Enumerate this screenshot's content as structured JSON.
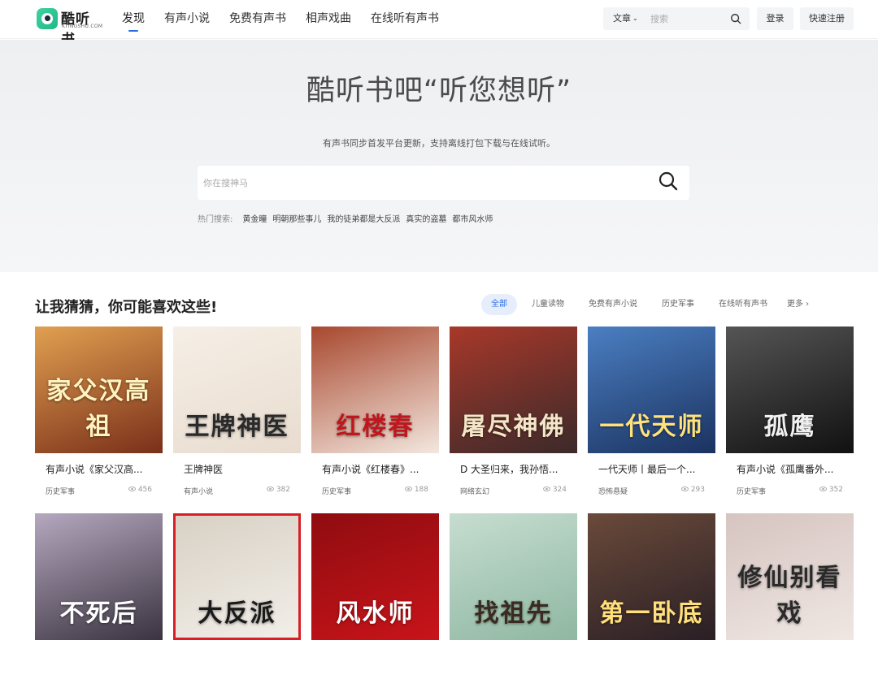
{
  "header": {
    "logo_title": "酷听书",
    "logo_sub": "KTINGSHU.COM",
    "nav": [
      "发现",
      "有声小说",
      "免费有声书",
      "相声戏曲",
      "在线听有声书"
    ],
    "search_category": "文章",
    "search_placeholder": "搜索",
    "login": "登录",
    "register": "快速注册"
  },
  "hero": {
    "title": "酷听书吧“听您想听”",
    "subtitle": "有声书同步首发平台更新，支持离线打包下载与在线试听。",
    "search_placeholder": "你在搜神马",
    "hot_label": "热门搜索:",
    "hot_items": [
      "黄金瞳",
      "明朝那些事儿",
      "我的徒弟都是大反派",
      "真实的盗墓",
      "都市风水师"
    ]
  },
  "recommend": {
    "title": "让我猜猜，你可能喜欢这些!",
    "tabs": [
      "全部",
      "儿童读物",
      "免费有声小说",
      "历史军事",
      "在线听有声书"
    ],
    "more": "更多 ›",
    "books": [
      {
        "title": "有声小说《家父汉高...",
        "category": "历史军事",
        "plays": "456",
        "cover_text": "家父汉高祖",
        "bg": "#7a2f1a",
        "bg2": "#e0a050",
        "fg": "#fff3c0"
      },
      {
        "title": "王牌神医",
        "category": "有声小说",
        "plays": "382",
        "cover_text": "王牌神医",
        "bg": "#e8dccf",
        "bg2": "#f6efe6",
        "fg": "#2a2a2a"
      },
      {
        "title": "有声小说《红楼春》...",
        "category": "历史军事",
        "plays": "188",
        "cover_text": "红楼春",
        "bg": "#f3e7df",
        "bg2": "#a8482e",
        "fg": "#c0161c"
      },
      {
        "title": "D 大圣归来，我孙悟...",
        "category": "网络玄幻",
        "plays": "324",
        "cover_text": "屠尽神佛",
        "bg": "#3b2a2a",
        "bg2": "#a8382a",
        "fg": "#f4e6c8"
      },
      {
        "title": "一代天师丨最后一个...",
        "category": "恐怖悬疑",
        "plays": "293",
        "cover_text": "一代天师",
        "bg": "#1b3260",
        "bg2": "#4b7fc2",
        "fg": "#ffe27a"
      },
      {
        "title": "有声小说《孤鹰番外...",
        "category": "历史军事",
        "plays": "352",
        "cover_text": "孤鹰",
        "bg": "#111111",
        "bg2": "#555555",
        "fg": "#f0f0f0"
      },
      {
        "title": "",
        "category": "",
        "plays": "",
        "cover_text": "不死后",
        "bg": "#3a3340",
        "bg2": "#b5a8bf",
        "fg": "#ffffff"
      },
      {
        "title": "",
        "category": "",
        "plays": "",
        "cover_text": "大反派",
        "bg": "#f2efe9",
        "bg2": "#d8d0c4",
        "fg": "#1a1a1a"
      },
      {
        "title": "",
        "category": "",
        "plays": "",
        "cover_text": "风水师",
        "bg": "#c8141a",
        "bg2": "#8f0c10",
        "fg": "#ffffff"
      },
      {
        "title": "",
        "category": "",
        "plays": "",
        "cover_text": "找祖先",
        "bg": "#8fb7a2",
        "bg2": "#c6ddd0",
        "fg": "#3a2a20"
      },
      {
        "title": "",
        "category": "",
        "plays": "",
        "cover_text": "第一卧底",
        "bg": "#2a1f25",
        "bg2": "#6a4a3a",
        "fg": "#ffe07a"
      },
      {
        "title": "",
        "category": "",
        "plays": "",
        "cover_text": "修仙别看戏",
        "bg": "#efe7e3",
        "bg2": "#d6c4c0",
        "fg": "#2a2a2a"
      }
    ]
  },
  "colors": {
    "accent": "#2b6be6",
    "hero_bg": "#f1f2f4"
  }
}
